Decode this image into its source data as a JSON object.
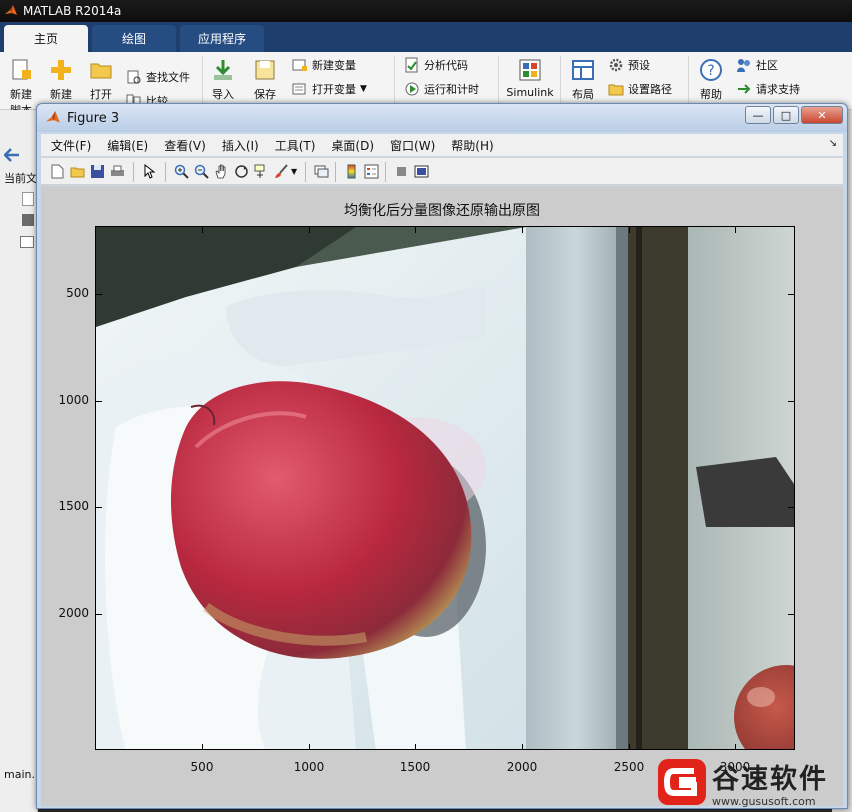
{
  "app": {
    "title": "MATLAB R2014a"
  },
  "tabs": [
    {
      "label": "主页",
      "active": true
    },
    {
      "label": "绘图",
      "active": false
    },
    {
      "label": "应用程序",
      "active": false
    }
  ],
  "ribbon": {
    "new_script": "新建\n脚本",
    "new": "新建",
    "open": "打开",
    "find_files": "查找文件",
    "compare": "比较",
    "import": "导入",
    "save": "保存",
    "new_variable": "新建变量",
    "open_variable": "打开变量",
    "analyze_code": "分析代码",
    "run_and_time": "运行和计时",
    "simulink": "Simulink",
    "layout": "布局",
    "preferences": "预设",
    "set_path": "设置路径",
    "help": "帮助",
    "community": "社区",
    "request_support": "请求支持"
  },
  "left_panel": {
    "current_folder": "当前文",
    "file_tab": "main."
  },
  "figure": {
    "title": "Figure 3",
    "menus": [
      "文件(F)",
      "编辑(E)",
      "查看(V)",
      "插入(I)",
      "工具(T)",
      "桌面(D)",
      "窗口(W)",
      "帮助(H)"
    ],
    "window_buttons": {
      "minimize": "—",
      "maximize": "□",
      "close": "✕"
    }
  },
  "plot": {
    "title": "均衡化后分量图像还原输出原图",
    "x_ticks": [
      "500",
      "1000",
      "1500",
      "2000",
      "2500",
      "3000"
    ],
    "y_ticks": [
      "500",
      "1000",
      "1500",
      "2000"
    ]
  },
  "chart_data": {
    "type": "image",
    "title": "均衡化后分量图像还原输出原图",
    "xlabel": "",
    "ylabel": "",
    "x_ticks": [
      500,
      1000,
      1500,
      2000,
      2500,
      3000
    ],
    "y_ticks": [
      500,
      1000,
      1500,
      2000
    ],
    "xlim": [
      0,
      3264
    ],
    "ylim": [
      2448,
      0
    ],
    "content": "apple on styrofoam"
  },
  "watermark": {
    "text": "谷速软件",
    "url": "www.gususoft.com"
  },
  "colors": {
    "ribbon_tab_bar": "#1e3f6e",
    "figure_frame": "#c7d7ea",
    "watermark_red": "#e2231a"
  }
}
